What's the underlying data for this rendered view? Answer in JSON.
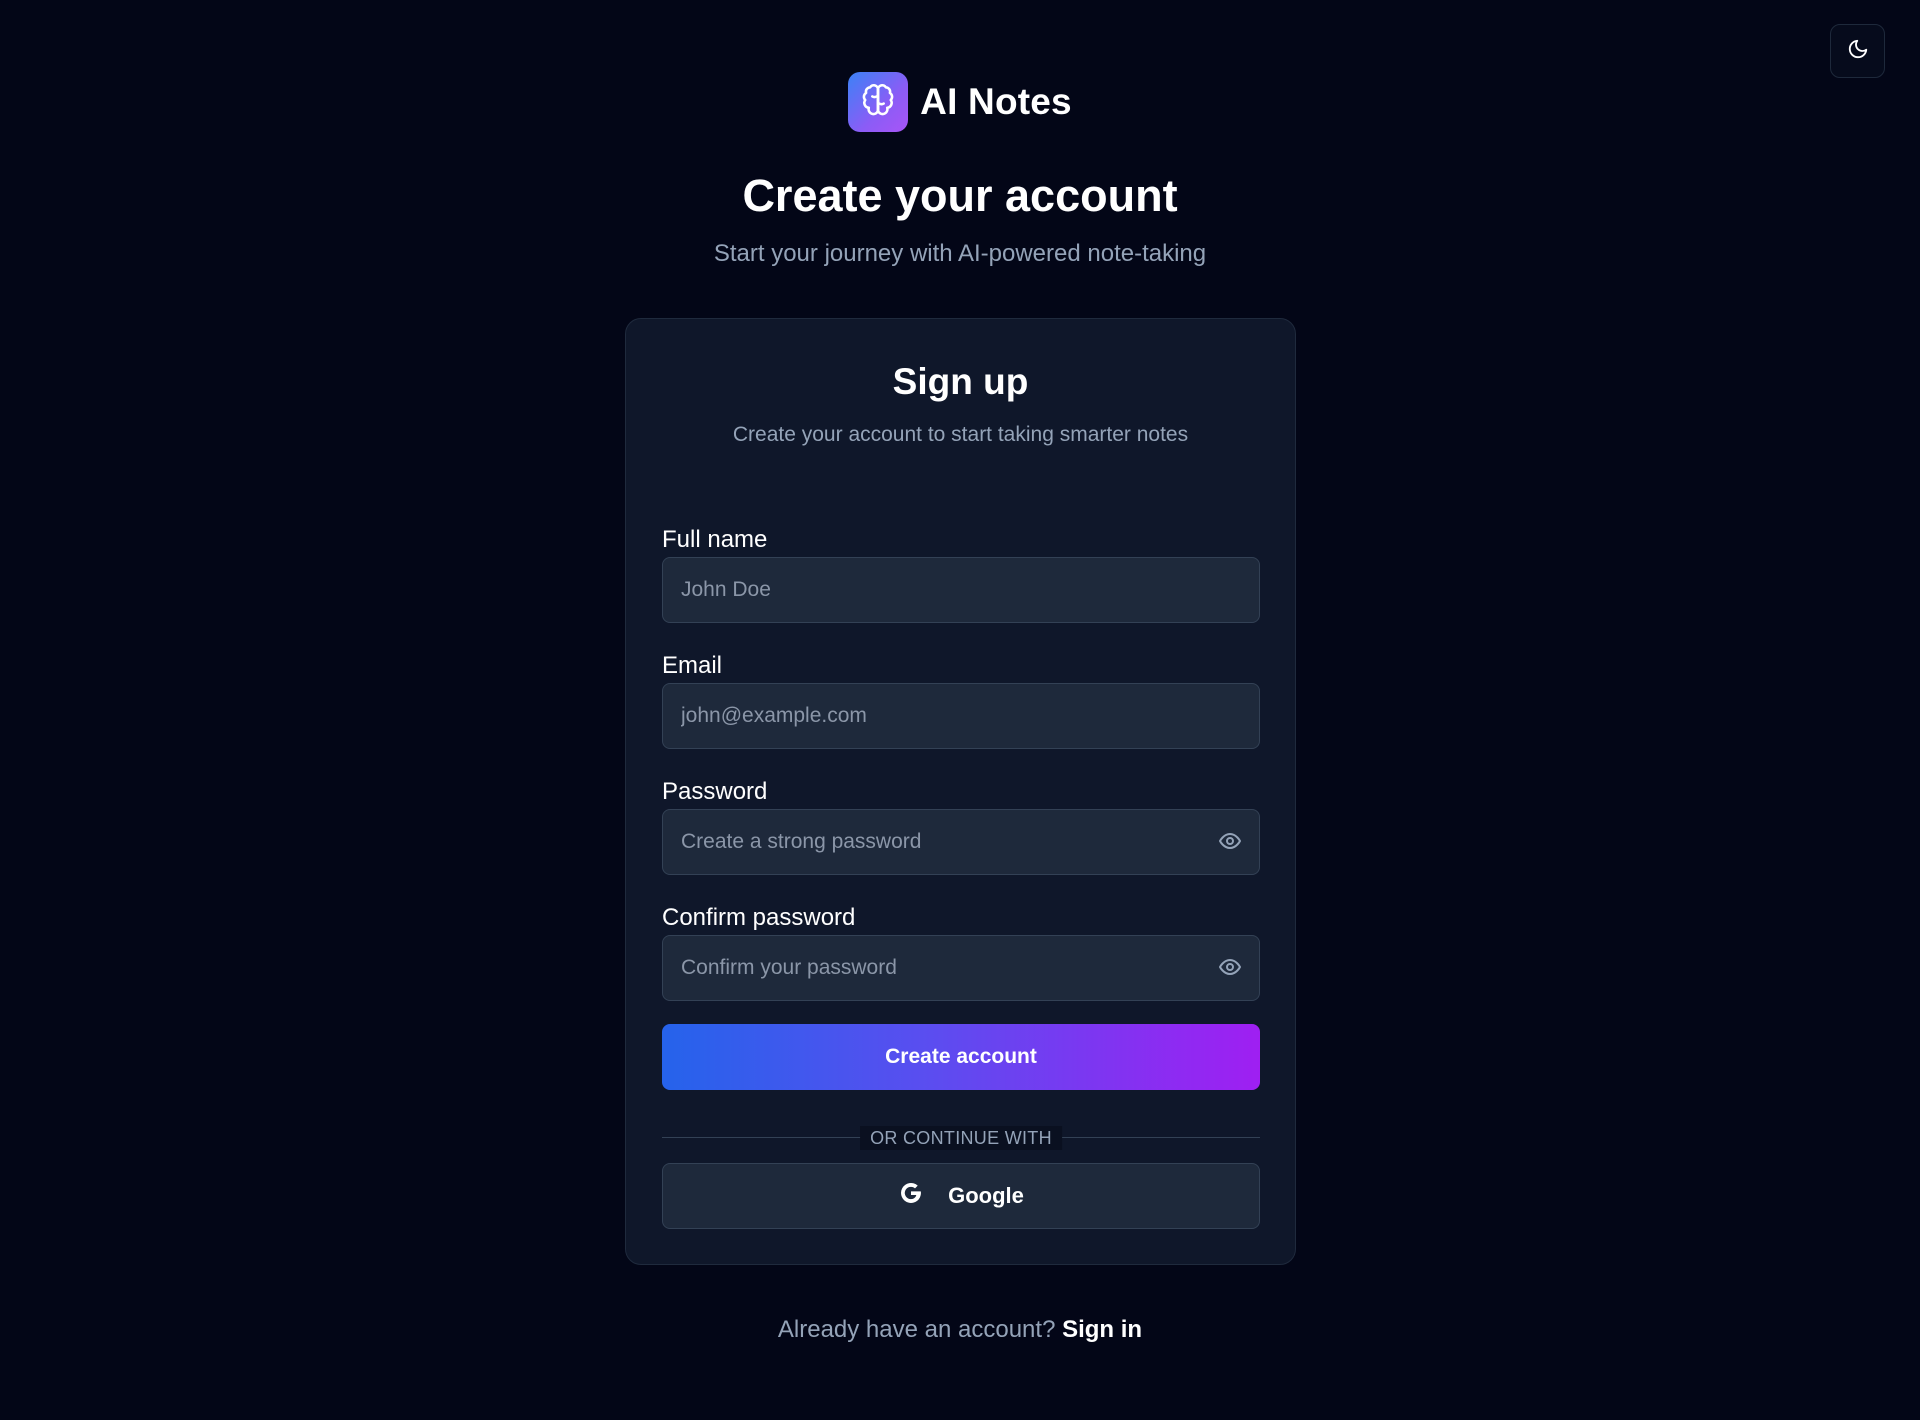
{
  "theme_toggle": {
    "icon": "moon-icon"
  },
  "brand": {
    "name": "AI Notes",
    "logo_icon": "brain-icon",
    "logo_gradient": [
      "#3b82f6",
      "#a855f7"
    ]
  },
  "hero": {
    "title": "Create your account",
    "subtitle": "Start your journey with AI-powered note-taking"
  },
  "card": {
    "title": "Sign up",
    "subtitle": "Create your account to start taking smarter notes",
    "fields": {
      "full_name": {
        "label": "Full name",
        "placeholder": "John Doe",
        "value": ""
      },
      "email": {
        "label": "Email",
        "placeholder": "john@example.com",
        "value": ""
      },
      "password": {
        "label": "Password",
        "placeholder": "Create a strong password",
        "value": "",
        "toggle_icon": "eye-icon"
      },
      "confirm_password": {
        "label": "Confirm password",
        "placeholder": "Confirm your password",
        "value": "",
        "toggle_icon": "eye-icon"
      }
    },
    "submit_label": "Create account",
    "submit_gradient": [
      "#2563eb",
      "#9f1ff2"
    ],
    "divider_text": "OR CONTINUE WITH",
    "google": {
      "label": "Google",
      "icon": "google-icon"
    }
  },
  "footer": {
    "prompt": "Already have an account?",
    "link_label": "Sign in"
  }
}
